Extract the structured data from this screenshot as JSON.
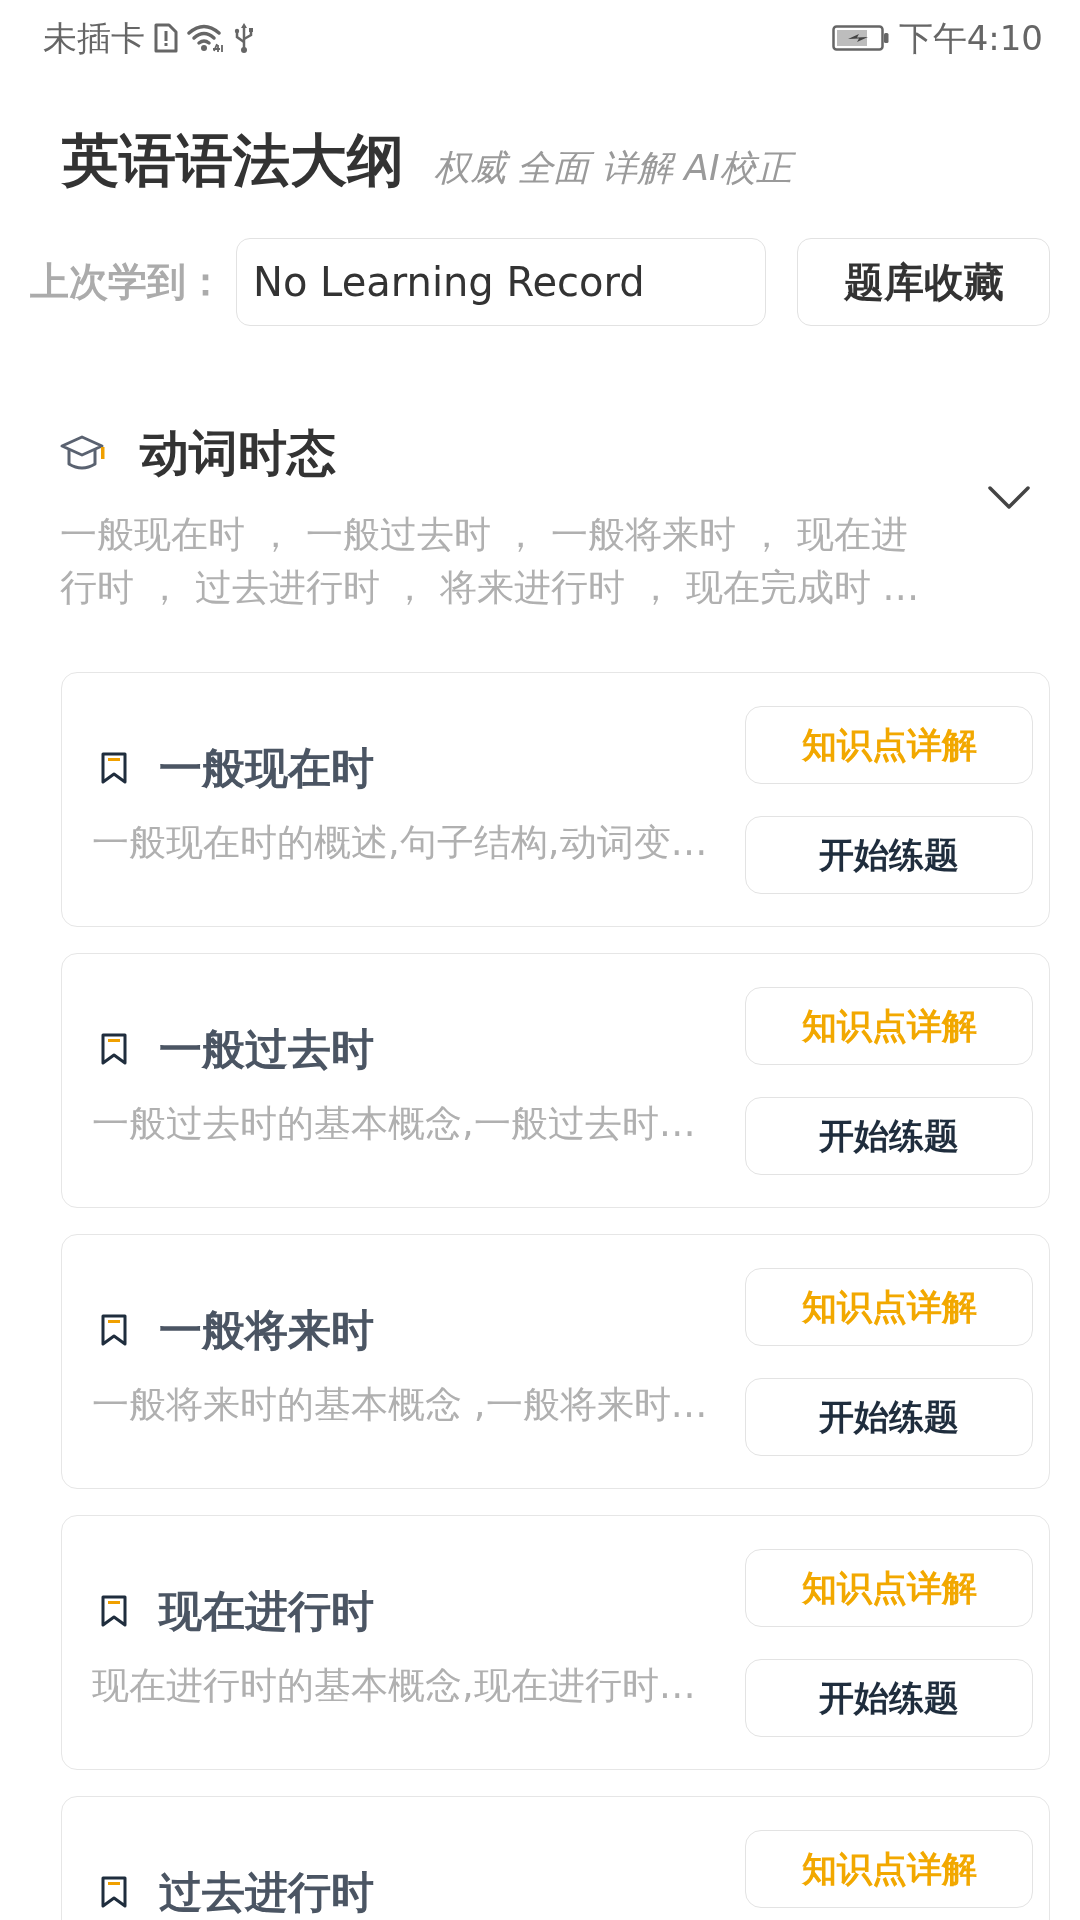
{
  "status_bar": {
    "carrier": "未插卡",
    "time": "下午4:10"
  },
  "header": {
    "title": "英语语法大纲",
    "subtitle": "权威 全面 详解 AI校正"
  },
  "last_learned": {
    "label": "上次学到：",
    "value": "No Learning Record"
  },
  "favorites_button": "题库收藏",
  "section": {
    "title": "动词时态",
    "expanded": true,
    "summary": "一般现在时 ， 一般过去时 ， 一般将来时 ， 现在进行时 ， 过去进行时 ， 将来进行时 ， 现在完成时 …",
    "lessons": [
      {
        "title": "一般现在时",
        "description": "一般现在时的概述,句子结构,动词变…",
        "buttons": [
          {
            "kind": "detail",
            "label": "知识点详解"
          },
          {
            "kind": "practice",
            "label": "开始练题"
          }
        ]
      },
      {
        "title": "一般过去时",
        "description": "一般过去时的基本概念,一般过去时…",
        "buttons": [
          {
            "kind": "detail",
            "label": "知识点详解"
          },
          {
            "kind": "practice",
            "label": "开始练题"
          }
        ]
      },
      {
        "title": "一般将来时",
        "description": "一般将来时的基本概念 ,一般将来时…",
        "buttons": [
          {
            "kind": "detail",
            "label": "知识点详解"
          },
          {
            "kind": "practice",
            "label": "开始练题"
          }
        ]
      },
      {
        "title": "现在进行时",
        "description": "现在进行时的基本概念,现在进行时…",
        "buttons": [
          {
            "kind": "detail",
            "label": "知识点详解"
          },
          {
            "kind": "practice",
            "label": "开始练题"
          }
        ]
      },
      {
        "title": "过去进行时",
        "buttons": [
          {
            "kind": "detail",
            "label": "知识点详解"
          }
        ]
      }
    ]
  }
}
